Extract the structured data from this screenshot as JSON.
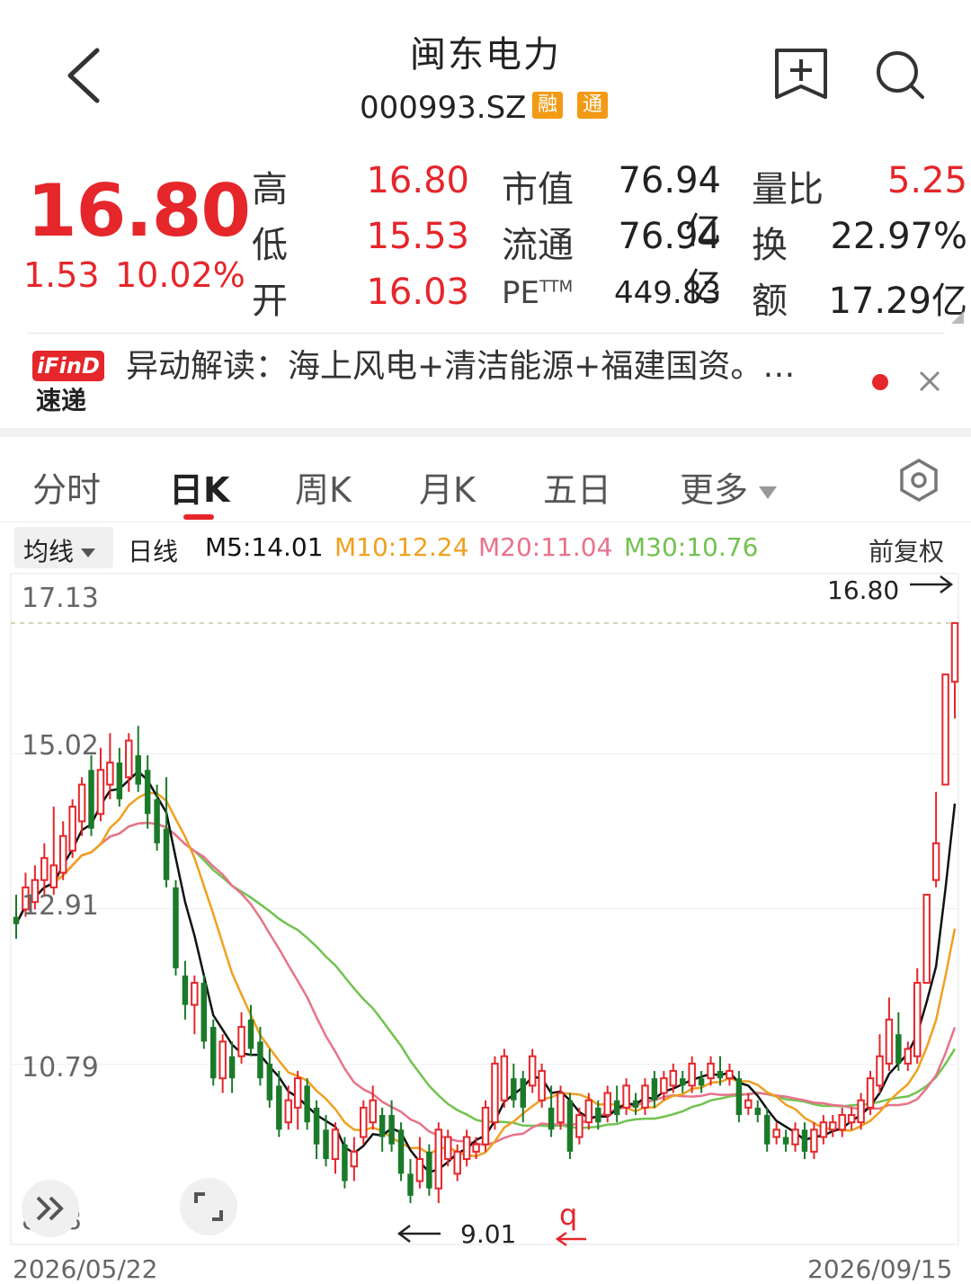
{
  "header": {
    "title": "闽东电力",
    "code": "000993.SZ",
    "tags": [
      "融",
      "通"
    ]
  },
  "quote": {
    "price": "16.80",
    "change": "1.53",
    "change_pct": "10.02%",
    "stats": [
      {
        "label": "高",
        "value": "16.80"
      },
      {
        "label": "低",
        "value": "15.53"
      },
      {
        "label": "开",
        "value": "16.03"
      }
    ],
    "mid": [
      {
        "label": "市值",
        "value": "76.94亿"
      },
      {
        "label": "流通",
        "value": "76.94亿"
      },
      {
        "label": "PE",
        "sup": "TTM",
        "value": "449.83"
      }
    ],
    "right": [
      {
        "label": "量比",
        "value": "5.25"
      },
      {
        "label": "换",
        "value": "22.97%"
      },
      {
        "label": "额",
        "value": "17.29亿"
      }
    ]
  },
  "news": {
    "badge": "iFinD",
    "badge_sub": "速递",
    "text": "异动解读：海上风电+清洁能源+福建国资。…"
  },
  "tabs": [
    "分时",
    "日K",
    "周K",
    "月K",
    "五日",
    "更多"
  ],
  "active_tab": 1,
  "indicators": {
    "selector": "均线",
    "period": "日线",
    "m5": "M5:14.01",
    "m10": "M10:12.24",
    "m20": "M20:11.04",
    "m30": "M30:10.76",
    "adjust": "前复权"
  },
  "colors": {
    "up": "#e5262b",
    "down": "#1b7a2a",
    "m5": "#111111",
    "m10": "#f0a020",
    "m20": "#e8738a",
    "m30": "#72c24f"
  },
  "chart_data": {
    "type": "candlestick",
    "y_ticks": [
      "17.13",
      "15.02",
      "12.91",
      "10.79",
      "8.68"
    ],
    "ylim": [
      8.68,
      17.13
    ],
    "x_labels": [
      "2026/05/22",
      "2026/09/15"
    ],
    "high_marker": "16.80",
    "low_marker": "9.01",
    "candles": [
      {
        "o": 12.8,
        "c": 12.7,
        "h": 13.1,
        "l": 12.5
      },
      {
        "o": 12.9,
        "c": 13.2,
        "h": 13.4,
        "l": 12.8
      },
      {
        "o": 13.0,
        "c": 13.3,
        "h": 13.5,
        "l": 12.9
      },
      {
        "o": 13.3,
        "c": 13.6,
        "h": 13.8,
        "l": 13.1
      },
      {
        "o": 13.2,
        "c": 13.5,
        "h": 14.3,
        "l": 13.1
      },
      {
        "o": 13.4,
        "c": 13.9,
        "h": 14.1,
        "l": 13.3
      },
      {
        "o": 13.7,
        "c": 14.3,
        "h": 14.4,
        "l": 13.6
      },
      {
        "o": 14.1,
        "c": 14.6,
        "h": 14.7,
        "l": 13.9
      },
      {
        "o": 14.8,
        "c": 14.0,
        "h": 15.0,
        "l": 13.9
      },
      {
        "o": 14.2,
        "c": 14.8,
        "h": 15.1,
        "l": 14.1
      },
      {
        "o": 14.6,
        "c": 14.9,
        "h": 15.3,
        "l": 14.4
      },
      {
        "o": 14.9,
        "c": 14.4,
        "h": 15.1,
        "l": 14.3
      },
      {
        "o": 14.7,
        "c": 15.2,
        "h": 15.3,
        "l": 14.5
      },
      {
        "o": 15.0,
        "c": 14.6,
        "h": 15.4,
        "l": 14.5
      },
      {
        "o": 14.8,
        "c": 14.2,
        "h": 15.0,
        "l": 14.0
      },
      {
        "o": 14.4,
        "c": 13.8,
        "h": 14.6,
        "l": 13.7
      },
      {
        "o": 14.0,
        "c": 13.3,
        "h": 14.7,
        "l": 13.2
      },
      {
        "o": 13.2,
        "c": 12.1,
        "h": 13.3,
        "l": 12.0
      },
      {
        "o": 12.0,
        "c": 11.6,
        "h": 12.2,
        "l": 11.4
      },
      {
        "o": 11.6,
        "c": 11.9,
        "h": 12.0,
        "l": 11.2
      },
      {
        "o": 11.9,
        "c": 11.1,
        "h": 12.0,
        "l": 11.0
      },
      {
        "o": 11.3,
        "c": 10.6,
        "h": 11.4,
        "l": 10.5
      },
      {
        "o": 10.6,
        "c": 11.1,
        "h": 11.2,
        "l": 10.4
      },
      {
        "o": 10.9,
        "c": 10.6,
        "h": 11.1,
        "l": 10.4
      },
      {
        "o": 10.9,
        "c": 11.3,
        "h": 11.5,
        "l": 10.8
      },
      {
        "o": 11.4,
        "c": 11.0,
        "h": 11.6,
        "l": 10.9
      },
      {
        "o": 11.1,
        "c": 10.6,
        "h": 11.3,
        "l": 10.5
      },
      {
        "o": 10.8,
        "c": 10.3,
        "h": 11.0,
        "l": 10.2
      },
      {
        "o": 10.5,
        "c": 9.9,
        "h": 10.7,
        "l": 9.8
      },
      {
        "o": 10.0,
        "c": 10.3,
        "h": 10.5,
        "l": 9.9
      },
      {
        "o": 10.2,
        "c": 10.6,
        "h": 10.7,
        "l": 9.9
      },
      {
        "o": 10.5,
        "c": 10.0,
        "h": 10.6,
        "l": 9.9
      },
      {
        "o": 10.2,
        "c": 9.7,
        "h": 10.3,
        "l": 9.5
      },
      {
        "o": 9.9,
        "c": 9.5,
        "h": 10.1,
        "l": 9.4
      },
      {
        "o": 9.5,
        "c": 9.9,
        "h": 10.0,
        "l": 9.3
      },
      {
        "o": 9.7,
        "c": 9.2,
        "h": 9.8,
        "l": 9.1
      },
      {
        "o": 9.4,
        "c": 9.6,
        "h": 9.8,
        "l": 9.2
      },
      {
        "o": 9.8,
        "c": 10.2,
        "h": 10.3,
        "l": 9.7
      },
      {
        "o": 10.0,
        "c": 10.3,
        "h": 10.5,
        "l": 9.9
      },
      {
        "o": 10.1,
        "c": 9.8,
        "h": 10.2,
        "l": 9.6
      },
      {
        "o": 10.1,
        "c": 9.7,
        "h": 10.3,
        "l": 9.6
      },
      {
        "o": 9.9,
        "c": 9.3,
        "h": 10.0,
        "l": 9.2
      },
      {
        "o": 9.3,
        "c": 9.0,
        "h": 9.5,
        "l": 8.9
      },
      {
        "o": 9.2,
        "c": 9.5,
        "h": 9.8,
        "l": 9.1
      },
      {
        "o": 9.6,
        "c": 9.1,
        "h": 9.7,
        "l": 9.0
      },
      {
        "o": 9.1,
        "c": 9.9,
        "h": 10.0,
        "l": 8.9
      },
      {
        "o": 9.5,
        "c": 9.8,
        "h": 9.9,
        "l": 9.4
      },
      {
        "o": 9.3,
        "c": 9.6,
        "h": 9.7,
        "l": 9.2
      },
      {
        "o": 9.5,
        "c": 9.8,
        "h": 9.9,
        "l": 9.4
      },
      {
        "o": 9.6,
        "c": 9.7,
        "h": 9.8,
        "l": 9.5
      },
      {
        "o": 9.7,
        "c": 10.2,
        "h": 10.3,
        "l": 9.6
      },
      {
        "o": 10.0,
        "c": 10.8,
        "h": 10.9,
        "l": 9.9
      },
      {
        "o": 10.3,
        "c": 10.9,
        "h": 11.0,
        "l": 10.2
      },
      {
        "o": 10.6,
        "c": 10.3,
        "h": 10.8,
        "l": 10.2
      },
      {
        "o": 10.6,
        "c": 10.2,
        "h": 10.7,
        "l": 10.0
      },
      {
        "o": 10.5,
        "c": 10.9,
        "h": 11.0,
        "l": 10.4
      },
      {
        "o": 10.3,
        "c": 10.7,
        "h": 10.8,
        "l": 10.2
      },
      {
        "o": 10.2,
        "c": 9.9,
        "h": 10.5,
        "l": 9.8
      },
      {
        "o": 10.0,
        "c": 10.4,
        "h": 10.5,
        "l": 9.9
      },
      {
        "o": 10.3,
        "c": 9.6,
        "h": 10.4,
        "l": 9.5
      },
      {
        "o": 9.8,
        "c": 10.1,
        "h": 10.2,
        "l": 9.7
      },
      {
        "o": 10.0,
        "c": 10.3,
        "h": 10.4,
        "l": 9.9
      },
      {
        "o": 10.2,
        "c": 10.0,
        "h": 10.3,
        "l": 9.9
      }
    ],
    "tail": [
      {
        "o": 10.1,
        "c": 10.4,
        "h": 10.5,
        "l": 10.0
      },
      {
        "o": 10.3,
        "c": 10.1,
        "h": 10.5,
        "l": 10.0
      },
      {
        "o": 10.2,
        "c": 10.5,
        "h": 10.6,
        "l": 10.1
      },
      {
        "o": 10.3,
        "c": 10.2,
        "h": 10.4,
        "l": 10.1
      },
      {
        "o": 10.2,
        "c": 10.5,
        "h": 10.6,
        "l": 10.1
      },
      {
        "o": 10.6,
        "c": 10.3,
        "h": 10.7,
        "l": 10.2
      },
      {
        "o": 10.4,
        "c": 10.6,
        "h": 10.7,
        "l": 10.3
      },
      {
        "o": 10.5,
        "c": 10.7,
        "h": 10.8,
        "l": 10.4
      },
      {
        "o": 10.6,
        "c": 10.5,
        "h": 10.7,
        "l": 10.4
      },
      {
        "o": 10.5,
        "c": 10.8,
        "h": 10.9,
        "l": 10.4
      },
      {
        "o": 10.6,
        "c": 10.5,
        "h": 10.7,
        "l": 10.4
      },
      {
        "o": 10.6,
        "c": 10.8,
        "h": 10.9,
        "l": 10.5
      },
      {
        "o": 10.7,
        "c": 10.6,
        "h": 10.9,
        "l": 10.5
      },
      {
        "o": 10.6,
        "c": 10.7,
        "h": 10.8,
        "l": 10.5
      },
      {
        "o": 10.6,
        "c": 10.1,
        "h": 10.7,
        "l": 10.0
      },
      {
        "o": 10.2,
        "c": 10.3,
        "h": 10.4,
        "l": 10.1
      },
      {
        "o": 10.2,
        "c": 10.1,
        "h": 10.3,
        "l": 10.0
      },
      {
        "o": 10.1,
        "c": 9.7,
        "h": 10.2,
        "l": 9.6
      },
      {
        "o": 9.8,
        "c": 9.9,
        "h": 10.0,
        "l": 9.7
      },
      {
        "o": 9.8,
        "c": 9.7,
        "h": 9.9,
        "l": 9.6
      },
      {
        "o": 9.7,
        "c": 9.9,
        "h": 10.0,
        "l": 9.6
      },
      {
        "o": 9.9,
        "c": 9.6,
        "h": 10.0,
        "l": 9.5
      },
      {
        "o": 9.6,
        "c": 9.9,
        "h": 10.0,
        "l": 9.5
      },
      {
        "o": 9.8,
        "c": 10.0,
        "h": 10.1,
        "l": 9.7
      },
      {
        "o": 9.9,
        "c": 10.0,
        "h": 10.1,
        "l": 9.8
      },
      {
        "o": 9.9,
        "c": 10.1,
        "h": 10.2,
        "l": 9.8
      },
      {
        "o": 10.0,
        "c": 10.1,
        "h": 10.2,
        "l": 9.9
      },
      {
        "o": 10.0,
        "c": 10.3,
        "h": 10.4,
        "l": 9.9
      },
      {
        "o": 10.2,
        "c": 10.6,
        "h": 10.7,
        "l": 10.1
      },
      {
        "o": 10.5,
        "c": 10.9,
        "h": 11.2,
        "l": 10.4
      },
      {
        "o": 10.8,
        "c": 11.4,
        "h": 11.7,
        "l": 10.7
      },
      {
        "o": 11.2,
        "c": 10.8,
        "h": 11.5,
        "l": 10.7
      },
      {
        "o": 10.8,
        "c": 11.0,
        "h": 11.1,
        "l": 10.7
      },
      {
        "o": 10.9,
        "c": 11.9,
        "h": 12.1,
        "l": 10.8
      },
      {
        "o": 11.9,
        "c": 13.1,
        "h": 13.1,
        "l": 11.9
      },
      {
        "o": 13.3,
        "c": 13.8,
        "h": 14.5,
        "l": 13.2
      },
      {
        "o": 14.6,
        "c": 16.1,
        "h": 16.1,
        "l": 14.6
      },
      {
        "o": 16.0,
        "c": 16.8,
        "h": 16.8,
        "l": 15.5
      }
    ]
  }
}
